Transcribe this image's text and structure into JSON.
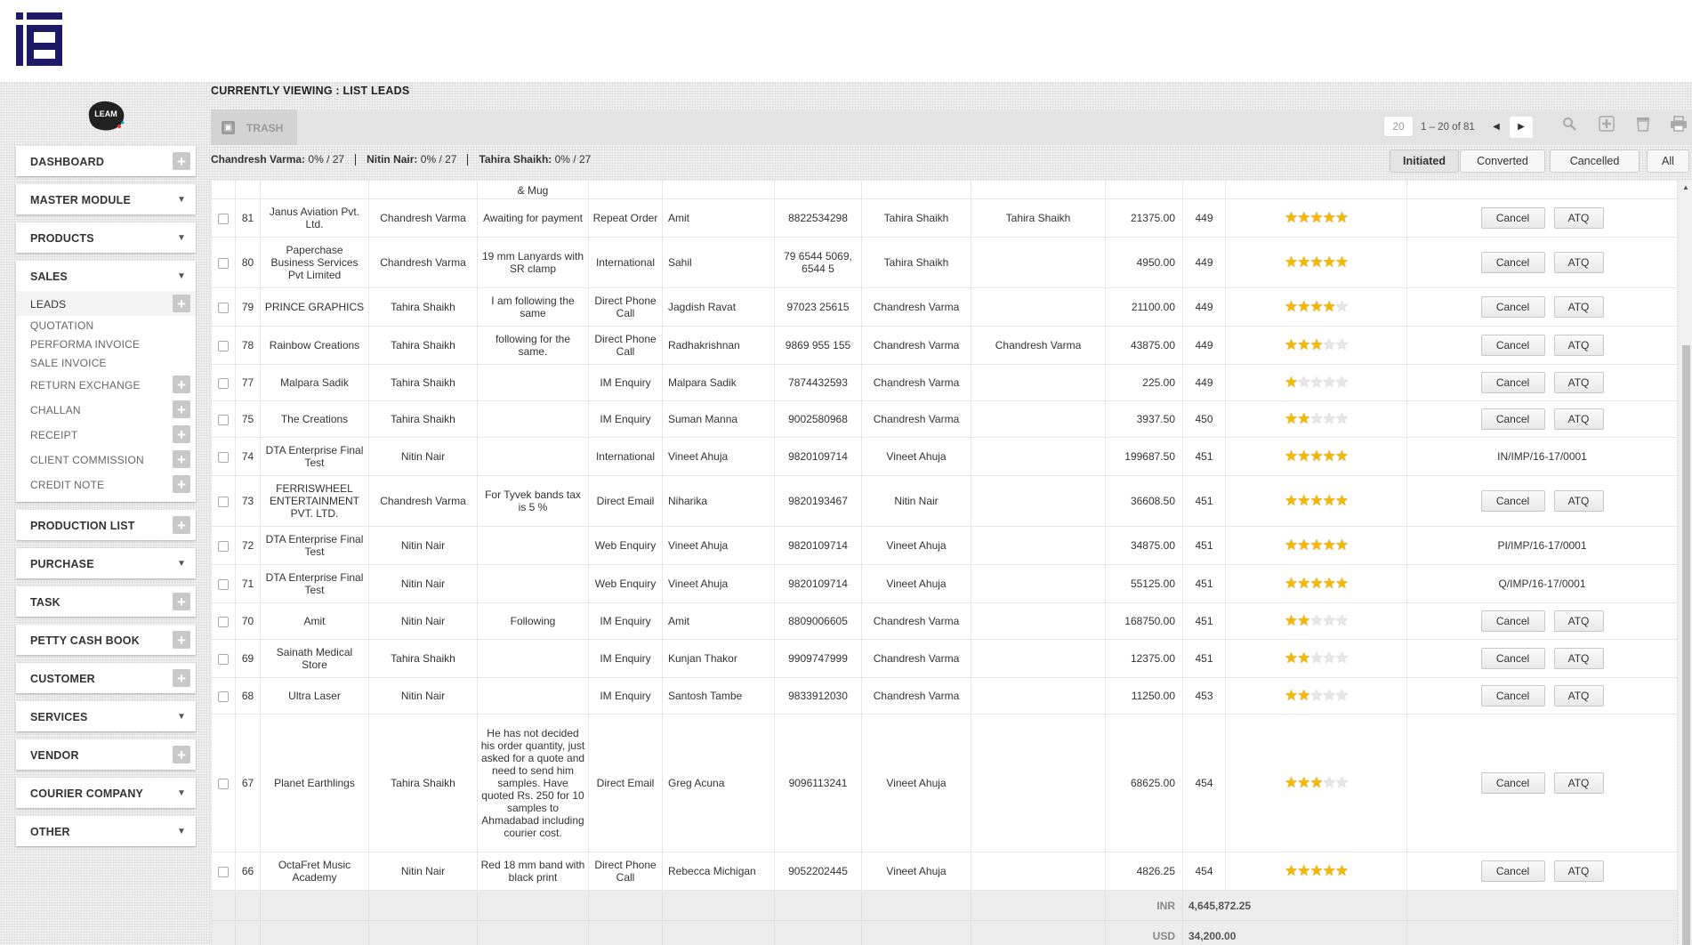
{
  "header": {
    "logo_name": "iq-logo"
  },
  "brand": {
    "logo_name": "leam-logo",
    "logo_text": "LEAM"
  },
  "sidebar": {
    "items_before": [
      {
        "label": "DASHBOARD",
        "control": "plus"
      },
      {
        "label": "MASTER MODULE",
        "control": "chevron"
      },
      {
        "label": "PRODUCTS",
        "control": "chevron"
      }
    ],
    "sales": {
      "label": "SALES",
      "subitems": [
        {
          "label": "LEADS",
          "control": "plus",
          "active": true
        },
        {
          "label": "QUOTATION",
          "control": "none"
        },
        {
          "label": "PERFORMA INVOICE",
          "control": "none"
        },
        {
          "label": "SALE INVOICE",
          "control": "none"
        },
        {
          "label": "RETURN EXCHANGE",
          "control": "plus"
        },
        {
          "label": "CHALLAN",
          "control": "plus"
        },
        {
          "label": "RECEIPT",
          "control": "plus"
        },
        {
          "label": "CLIENT COMMISSION",
          "control": "plus"
        },
        {
          "label": "CREDIT NOTE",
          "control": "plus"
        }
      ]
    },
    "items_after": [
      {
        "label": "PRODUCTION LIST",
        "control": "plus"
      },
      {
        "label": "PURCHASE",
        "control": "chevron"
      },
      {
        "label": "TASK",
        "control": "plus"
      },
      {
        "label": "PETTY CASH BOOK",
        "control": "plus"
      },
      {
        "label": "CUSTOMER",
        "control": "plus"
      },
      {
        "label": "SERVICES",
        "control": "chevron"
      },
      {
        "label": "VENDOR",
        "control": "plus"
      },
      {
        "label": "COURIER COMPANY",
        "control": "chevron"
      },
      {
        "label": "OTHER",
        "control": "chevron"
      }
    ]
  },
  "main": {
    "view_title": "CURRENTLY VIEWING : LIST LEADS",
    "toolbar": {
      "trash_label": "TRASH",
      "page_size": "20",
      "page_range": "1 – 20 of 81"
    },
    "quotas": [
      {
        "name": "Chandresh Varma:",
        "value": "0% / 27"
      },
      {
        "name": "Nitin Nair:",
        "value": "0% / 27"
      },
      {
        "name": "Tahira Shaikh:",
        "value": "0% / 27"
      }
    ],
    "status_filters": [
      {
        "label": "Initiated",
        "active": true
      },
      {
        "label": "Converted",
        "active": false
      },
      {
        "label": "Cancelled",
        "active": false
      },
      {
        "label": "All",
        "active": false
      }
    ],
    "partial_row_note": "& Mug",
    "rows": [
      {
        "id": "81",
        "company": "Janus Aviation Pvt. Ltd.",
        "owner": "Chandresh Varma",
        "remark": "Awaiting for payment",
        "source": "Repeat Order",
        "contact": "Amit",
        "phone": "8822534298",
        "assigned": "Tahira Shaikh",
        "handler": "Tahira Shaikh",
        "amount": "21375.00",
        "days": "449",
        "rating": 5,
        "action": "buttons",
        "ref": ""
      },
      {
        "id": "80",
        "company": "Paperchase Business Services Pvt Limited",
        "owner": "Chandresh Varma",
        "remark": "19 mm Lanyards with SR clamp",
        "source": "International",
        "contact": "Sahil",
        "phone": "79 6544 5069, 6544 5",
        "assigned": "Tahira Shaikh",
        "handler": "",
        "amount": "4950.00",
        "days": "449",
        "rating": 5,
        "action": "buttons",
        "ref": ""
      },
      {
        "id": "79",
        "company": "PRINCE GRAPHICS",
        "owner": "Tahira Shaikh",
        "remark": "I am following the same",
        "source": "Direct Phone Call",
        "contact": "Jagdish Ravat",
        "phone": "97023 25615",
        "assigned": "Chandresh Varma",
        "handler": "",
        "amount": "21100.00",
        "days": "449",
        "rating": 4,
        "action": "buttons",
        "ref": ""
      },
      {
        "id": "78",
        "company": "Rainbow Creations",
        "owner": "Tahira Shaikh",
        "remark": "following for the same.",
        "source": "Direct Phone Call",
        "contact": "Radhakrishnan",
        "phone": "9869 955 155",
        "assigned": "Chandresh Varma",
        "handler": "Chandresh Varma",
        "amount": "43875.00",
        "days": "449",
        "rating": 3,
        "action": "buttons",
        "ref": ""
      },
      {
        "id": "77",
        "company": "Malpara Sadik",
        "owner": "Tahira Shaikh",
        "remark": "",
        "source": "IM Enquiry",
        "contact": "Malpara Sadik",
        "phone": "7874432593",
        "assigned": "Chandresh Varma",
        "handler": "",
        "amount": "225.00",
        "days": "449",
        "rating": 1,
        "action": "buttons",
        "ref": ""
      },
      {
        "id": "75",
        "company": "The Creations",
        "owner": "Tahira Shaikh",
        "remark": "",
        "source": "IM Enquiry",
        "contact": "Suman Manna",
        "phone": "9002580968",
        "assigned": "Chandresh Varma",
        "handler": "",
        "amount": "3937.50",
        "days": "450",
        "rating": 2,
        "action": "buttons",
        "ref": ""
      },
      {
        "id": "74",
        "company": "DTA Enterprise Final Test",
        "owner": "Nitin Nair",
        "remark": "",
        "source": "International",
        "contact": "Vineet Ahuja",
        "phone": "9820109714",
        "assigned": "Vineet Ahuja",
        "handler": "",
        "amount": "199687.50",
        "days": "451",
        "rating": 5,
        "action": "ref",
        "ref": "IN/IMP/16-17/0001"
      },
      {
        "id": "73",
        "company": "FERRISWHEEL ENTERTAINMENT PVT. LTD.",
        "owner": "Chandresh Varma",
        "remark": "For Tyvek bands tax is 5 %",
        "source": "Direct Email",
        "contact": "Niharika",
        "phone": "9820193467",
        "assigned": "Nitin Nair",
        "handler": "",
        "amount": "36608.50",
        "days": "451",
        "rating": 5,
        "action": "buttons",
        "ref": ""
      },
      {
        "id": "72",
        "company": "DTA Enterprise Final Test",
        "owner": "Nitin Nair",
        "remark": "",
        "source": "Web Enquiry",
        "contact": "Vineet Ahuja",
        "phone": "9820109714",
        "assigned": "Vineet Ahuja",
        "handler": "",
        "amount": "34875.00",
        "days": "451",
        "rating": 5,
        "action": "ref",
        "ref": "PI/IMP/16-17/0001"
      },
      {
        "id": "71",
        "company": "DTA Enterprise Final Test",
        "owner": "Nitin Nair",
        "remark": "",
        "source": "Web Enquiry",
        "contact": "Vineet Ahuja",
        "phone": "9820109714",
        "assigned": "Vineet Ahuja",
        "handler": "",
        "amount": "55125.00",
        "days": "451",
        "rating": 5,
        "action": "ref",
        "ref": "Q/IMP/16-17/0001"
      },
      {
        "id": "70",
        "company": "Amit",
        "owner": "Nitin Nair",
        "remark": "Following",
        "source": "IM Enquiry",
        "contact": "Amit",
        "phone": "8809006605",
        "assigned": "Chandresh Varma",
        "handler": "",
        "amount": "168750.00",
        "days": "451",
        "rating": 2,
        "action": "buttons",
        "ref": ""
      },
      {
        "id": "69",
        "company": "Sainath Medical Store",
        "owner": "Tahira Shaikh",
        "remark": "",
        "source": "IM Enquiry",
        "contact": "Kunjan Thakor",
        "phone": "9909747999",
        "assigned": "Chandresh Varma",
        "handler": "",
        "amount": "12375.00",
        "days": "451",
        "rating": 2,
        "action": "buttons",
        "ref": ""
      },
      {
        "id": "68",
        "company": "Ultra Laser",
        "owner": "Nitin Nair",
        "remark": "",
        "source": "IM Enquiry",
        "contact": "Santosh Tambe",
        "phone": "9833912030",
        "assigned": "Chandresh Varma",
        "handler": "",
        "amount": "11250.00",
        "days": "453",
        "rating": 2,
        "action": "buttons",
        "ref": ""
      },
      {
        "id": "67",
        "company": "Planet Earthlings",
        "owner": "Tahira Shaikh",
        "remark": "He has not decided his order quantity, just asked for a quote and need to send him samples. Have quoted Rs. 250 for 10 samples to Ahmadabad including courier cost.",
        "source": "Direct Email",
        "contact": "Greg Acuna",
        "phone": "9096113241",
        "assigned": "Vineet Ahuja",
        "handler": "",
        "amount": "68625.00",
        "days": "454",
        "rating": 3,
        "action": "buttons",
        "ref": ""
      },
      {
        "id": "66",
        "company": "OctaFret Music Academy",
        "owner": "Nitin Nair",
        "remark": "Red 18 mm band with black print",
        "source": "Direct Phone Call",
        "contact": "Rebecca Michigan",
        "phone": "9052202445",
        "assigned": "Vineet Ahuja",
        "handler": "",
        "amount": "4826.25",
        "days": "454",
        "rating": 5,
        "action": "buttons",
        "ref": ""
      }
    ],
    "row_actions": {
      "cancel_label": "Cancel",
      "atq_label": "ATQ"
    },
    "totals": [
      {
        "currency": "INR",
        "value": "4,645,872.25"
      },
      {
        "currency": "USD",
        "value": "34,200.00"
      }
    ]
  }
}
